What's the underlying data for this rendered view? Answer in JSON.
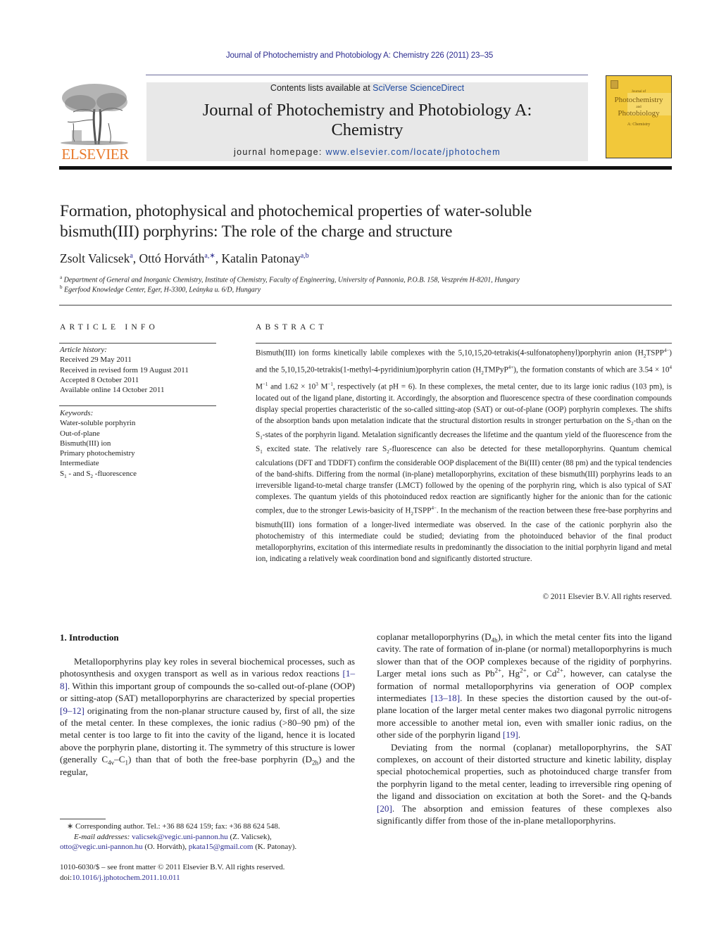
{
  "running_head": "Journal of Photochemistry and Photobiology A: Chemistry 226 (2011) 23–35",
  "masthead": {
    "publisher_logo_label": "ELSEVIER",
    "contents_prefix": "Contents lists available at ",
    "contents_link": "SciVerse ScienceDirect",
    "journal_title_line1": "Journal of Photochemistry and Photobiology A:",
    "journal_title_line2": "Chemistry",
    "homepage_prefix": "journal homepage: ",
    "homepage_link": "www.elsevier.com/locate/jphotochem",
    "cover": {
      "small_top": "Journal of",
      "big1": "Photochemistry",
      "and": "and",
      "big2": "Photobiology",
      "subtitle": "A: Chemistry"
    }
  },
  "article": {
    "title_line1": "Formation, photophysical and photochemical properties of water-soluble",
    "title_line2": "bismuth(III) porphyrins: The role of the charge and structure",
    "authors": [
      {
        "name": "Zsolt Valicsek",
        "sup": "a"
      },
      {
        "name": "Ottó Horváth",
        "sup": "a,∗"
      },
      {
        "name": "Katalin Patonay",
        "sup": "a,b"
      }
    ],
    "affiliations": [
      {
        "key": "a",
        "text": "Department of General and Inorganic Chemistry, Institute of Chemistry, Faculty of Engineering, University of Pannonia, P.O.B. 158, Veszprém H-8201, Hungary"
      },
      {
        "key": "b",
        "text": "Egerfood Knowledge Center, Eger, H-3300, Leányka u. 6/D, Hungary"
      }
    ]
  },
  "article_info": {
    "heading": "ARTICLE INFO",
    "history_label": "Article history:",
    "history": [
      "Received 29 May 2011",
      "Received in revised form 19 August 2011",
      "Accepted 8 October 2011",
      "Available online 14 October 2011"
    ],
    "keywords_label": "Keywords:",
    "keywords": [
      "Water-soluble porphyrin",
      "Out-of-plane",
      "Bismuth(III) ion",
      "Primary photochemistry",
      "Intermediate"
    ],
    "keyword_last": {
      "s1": "S",
      "sub1": "1",
      "mid": " - and S",
      "sub2": "2",
      "end": " -fluorescence"
    }
  },
  "abstract": {
    "heading": "ABSTRACT",
    "p1": "Bismuth(III) ion forms kinetically labile complexes with the 5,10,15,20-tetrakis(4-sulfonatophenyl)porphyrin anion (H",
    "p2": "TSPP",
    "p2sup": "4−",
    "p3": ") and the 5,10,15,20-tetrakis(1-methyl-4-pyridinium)porphyrin cation (H",
    "p4": "TMPyP",
    "p4sup": "4+",
    "p5": "), the formation constants of which are 3.54 × 10",
    "p5sup": "4",
    "p6": " M",
    "p6sup": "−1",
    "p7": " and 1.62 × 10",
    "p7sup": "3",
    "p8": " M",
    "p8sup": "−1",
    "p9": ", respectively (at pH = 6). In these complexes, the metal center, due to its large ionic radius (103 pm), is located out of the ligand plane, distorting it. Accordingly, the absorption and fluorescence spectra of these coordination compounds display special properties characteristic of the so-called sitting-atop (SAT) or out-of-plane (OOP) porphyrin complexes. The shifts of the absorption bands upon metalation indicate that the structural distortion results in stronger perturbation on the S",
    "p10": "-than on the S",
    "p11": "-states of the porphyrin ligand. Metalation significantly decreases the lifetime and the quantum yield of the fluorescence from the S",
    "p12": " excited state. The relatively rare S",
    "p13": "-fluorescence can also be detected for these metalloporphyrins. Quantum chemical calculations (DFT and TDDFT) confirm the considerable OOP displacement of the Bi(III) center (88 pm) and the typical tendencies of the band-shifts. Differing from the normal (in-plane) metalloporphyrins, excitation of these bismuth(III) porphyrins leads to an irreversible ligand-to-metal charge transfer (LMCT) followed by the opening of the porphyrin ring, which is also typical of SAT complexes. The quantum yields of this photoinduced redox reaction are significantly higher for the anionic than for the cationic complex, due to the stronger Lewis-basicity of H",
    "p14": "TSPP",
    "p14sup": "4−",
    "p15": ". In the mechanism of the reaction between these free-base porphyrins and bismuth(III) ions formation of a longer-lived intermediate was observed. In the case of the cationic porphyrin also the photochemistry of this intermediate could be studied; deviating from the photoinduced behavior of the final product metalloporphyrins, excitation of this intermediate results in predominantly the dissociation to the initial porphyrin ligand and metal ion, indicating a relatively weak coordination bond and significantly distorted structure.",
    "sub2": "2",
    "sub1": "1",
    "copyright": "© 2011 Elsevier B.V. All rights reserved."
  },
  "introduction": {
    "heading": "1.  Introduction",
    "left": {
      "a": "Metalloporphyrins play key roles in several biochemical processes, such as photosynthesis and oxygen transport as well as in various redox reactions ",
      "ref1": "[1–8]",
      "b": ". Within this important group of compounds the so-called out-of-plane (OOP) or sitting-atop (SAT) metalloporphyrins are characterized by special properties ",
      "ref2": "[9–12]",
      "c": " originating from the non-planar structure caused by, first of all, the size of the metal center. In these complexes, the ionic radius (>80–90 pm) of the metal center is too large to fit into the cavity of the ligand, hence it is located above the porphyrin plane, distorting it. The symmetry of this structure is lower (generally C",
      "c_sub": "4v",
      "d": "–C",
      "d_sub": "1",
      "e": ") than that of both the free-base porphyrin (D",
      "e_sub": "2h",
      "f": ") and the regular,"
    },
    "right": {
      "a": "coplanar metalloporphyrins (D",
      "a_sub": "4h",
      "b": "), in which the metal center fits into the ligand cavity. The rate of formation of in-plane (or normal) metalloporphyrins is much slower than that of the OOP complexes because of the rigidity of porphyrins. Larger metal ions such as Pb",
      "sup": "2+",
      "c": ", Hg",
      "d": ", or Cd",
      "e": ", however, can catalyse the formation of normal metalloporphyrins via generation of OOP complex intermediates ",
      "ref1": "[13–18]",
      "f": ". In these species the distortion caused by the out-of-plane location of the larger metal center makes two diagonal pyrrolic nitrogens more accessible to another metal ion, even with smaller ionic radius, on the other side of the porphyrin ligand ",
      "ref2": "[19]",
      "g": ".",
      "p2a": "Deviating from the normal (coplanar) metalloporphyrins, the SAT complexes, on account of their distorted structure and kinetic lability, display special photochemical properties, such as photoinduced charge transfer from the porphyrin ligand to the metal center, leading to irreversible ring opening of the ligand and dissociation on excitation at both the Soret- and the Q-bands ",
      "ref3": "[20]",
      "p2b": ". The absorption and emission features of these complexes also significantly differ from those of the in-plane metalloporphyrins."
    }
  },
  "footnotes": {
    "corresponding": "∗  Corresponding author. Tel.: +36 88 624 159; fax: +36 88 624 548.",
    "email_label": "E-mail addresses:",
    "email1": "valicsek@vegic.uni-pannon.hu",
    "email1_owner": " (Z. Valicsek),",
    "email2": "otto@vegic.uni-pannon.hu",
    "email2_owner": " (O. Horváth), ",
    "email3": "pkata15@gmail.com",
    "email3_owner": " (K. Patonay).",
    "front_matter": "1010-6030/$ – see front matter © 2011 Elsevier B.V. All rights reserved.",
    "doi_prefix": "doi:",
    "doi": "10.1016/j.jphotochem.2011.10.011"
  },
  "colors": {
    "link": "#2b2b8f",
    "elsevier_orange": "#e8792b",
    "masthead_gray": "#e8e8e8",
    "cover_yellow": "#f2c83a"
  }
}
